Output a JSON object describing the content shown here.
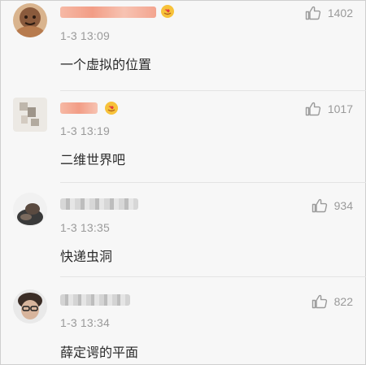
{
  "comments": [
    {
      "time": "1-3 13:09",
      "text": "一个虚拟的位置",
      "likes": "1402",
      "has_badge": true
    },
    {
      "time": "1-3 13:19",
      "text": "二维世界吧",
      "likes": "1017",
      "has_badge": true
    },
    {
      "time": "1-3 13:35",
      "text": "快递虫洞",
      "likes": "934",
      "has_badge": false
    },
    {
      "time": "1-3 13:34",
      "text": "薛定谔的平面",
      "likes": "822",
      "has_badge": false
    }
  ],
  "icons": {
    "like": "thumbs-up-icon",
    "badge": "heart-eyes-emoji-icon"
  },
  "colors": {
    "text": "#2b2b2b",
    "muted": "#9a9a9a",
    "name_blur": "#f3b5a0"
  }
}
